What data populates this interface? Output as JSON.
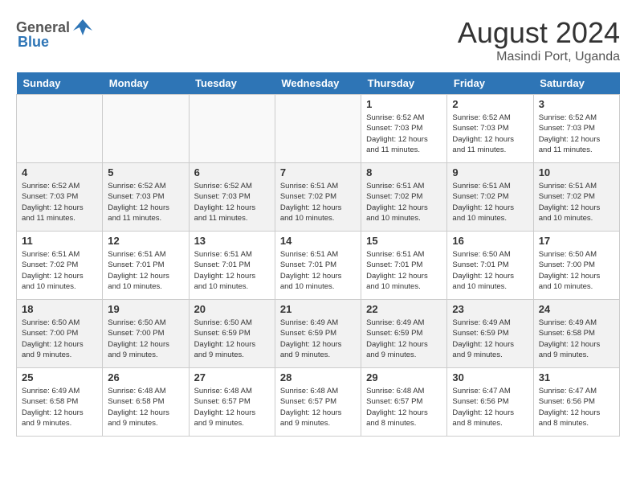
{
  "header": {
    "logo_general": "General",
    "logo_blue": "Blue",
    "month_year": "August 2024",
    "location": "Masindi Port, Uganda"
  },
  "days_of_week": [
    "Sunday",
    "Monday",
    "Tuesday",
    "Wednesday",
    "Thursday",
    "Friday",
    "Saturday"
  ],
  "weeks": [
    [
      {
        "day": "",
        "info": ""
      },
      {
        "day": "",
        "info": ""
      },
      {
        "day": "",
        "info": ""
      },
      {
        "day": "",
        "info": ""
      },
      {
        "day": "1",
        "info": "Sunrise: 6:52 AM\nSunset: 7:03 PM\nDaylight: 12 hours and 11 minutes."
      },
      {
        "day": "2",
        "info": "Sunrise: 6:52 AM\nSunset: 7:03 PM\nDaylight: 12 hours and 11 minutes."
      },
      {
        "day": "3",
        "info": "Sunrise: 6:52 AM\nSunset: 7:03 PM\nDaylight: 12 hours and 11 minutes."
      }
    ],
    [
      {
        "day": "4",
        "info": "Sunrise: 6:52 AM\nSunset: 7:03 PM\nDaylight: 12 hours and 11 minutes."
      },
      {
        "day": "5",
        "info": "Sunrise: 6:52 AM\nSunset: 7:03 PM\nDaylight: 12 hours and 11 minutes."
      },
      {
        "day": "6",
        "info": "Sunrise: 6:52 AM\nSunset: 7:03 PM\nDaylight: 12 hours and 11 minutes."
      },
      {
        "day": "7",
        "info": "Sunrise: 6:51 AM\nSunset: 7:02 PM\nDaylight: 12 hours and 10 minutes."
      },
      {
        "day": "8",
        "info": "Sunrise: 6:51 AM\nSunset: 7:02 PM\nDaylight: 12 hours and 10 minutes."
      },
      {
        "day": "9",
        "info": "Sunrise: 6:51 AM\nSunset: 7:02 PM\nDaylight: 12 hours and 10 minutes."
      },
      {
        "day": "10",
        "info": "Sunrise: 6:51 AM\nSunset: 7:02 PM\nDaylight: 12 hours and 10 minutes."
      }
    ],
    [
      {
        "day": "11",
        "info": "Sunrise: 6:51 AM\nSunset: 7:02 PM\nDaylight: 12 hours and 10 minutes."
      },
      {
        "day": "12",
        "info": "Sunrise: 6:51 AM\nSunset: 7:01 PM\nDaylight: 12 hours and 10 minutes."
      },
      {
        "day": "13",
        "info": "Sunrise: 6:51 AM\nSunset: 7:01 PM\nDaylight: 12 hours and 10 minutes."
      },
      {
        "day": "14",
        "info": "Sunrise: 6:51 AM\nSunset: 7:01 PM\nDaylight: 12 hours and 10 minutes."
      },
      {
        "day": "15",
        "info": "Sunrise: 6:51 AM\nSunset: 7:01 PM\nDaylight: 12 hours and 10 minutes."
      },
      {
        "day": "16",
        "info": "Sunrise: 6:50 AM\nSunset: 7:01 PM\nDaylight: 12 hours and 10 minutes."
      },
      {
        "day": "17",
        "info": "Sunrise: 6:50 AM\nSunset: 7:00 PM\nDaylight: 12 hours and 10 minutes."
      }
    ],
    [
      {
        "day": "18",
        "info": "Sunrise: 6:50 AM\nSunset: 7:00 PM\nDaylight: 12 hours and 9 minutes."
      },
      {
        "day": "19",
        "info": "Sunrise: 6:50 AM\nSunset: 7:00 PM\nDaylight: 12 hours and 9 minutes."
      },
      {
        "day": "20",
        "info": "Sunrise: 6:50 AM\nSunset: 6:59 PM\nDaylight: 12 hours and 9 minutes."
      },
      {
        "day": "21",
        "info": "Sunrise: 6:49 AM\nSunset: 6:59 PM\nDaylight: 12 hours and 9 minutes."
      },
      {
        "day": "22",
        "info": "Sunrise: 6:49 AM\nSunset: 6:59 PM\nDaylight: 12 hours and 9 minutes."
      },
      {
        "day": "23",
        "info": "Sunrise: 6:49 AM\nSunset: 6:59 PM\nDaylight: 12 hours and 9 minutes."
      },
      {
        "day": "24",
        "info": "Sunrise: 6:49 AM\nSunset: 6:58 PM\nDaylight: 12 hours and 9 minutes."
      }
    ],
    [
      {
        "day": "25",
        "info": "Sunrise: 6:49 AM\nSunset: 6:58 PM\nDaylight: 12 hours and 9 minutes."
      },
      {
        "day": "26",
        "info": "Sunrise: 6:48 AM\nSunset: 6:58 PM\nDaylight: 12 hours and 9 minutes."
      },
      {
        "day": "27",
        "info": "Sunrise: 6:48 AM\nSunset: 6:57 PM\nDaylight: 12 hours and 9 minutes."
      },
      {
        "day": "28",
        "info": "Sunrise: 6:48 AM\nSunset: 6:57 PM\nDaylight: 12 hours and 9 minutes."
      },
      {
        "day": "29",
        "info": "Sunrise: 6:48 AM\nSunset: 6:57 PM\nDaylight: 12 hours and 8 minutes."
      },
      {
        "day": "30",
        "info": "Sunrise: 6:47 AM\nSunset: 6:56 PM\nDaylight: 12 hours and 8 minutes."
      },
      {
        "day": "31",
        "info": "Sunrise: 6:47 AM\nSunset: 6:56 PM\nDaylight: 12 hours and 8 minutes."
      }
    ]
  ]
}
